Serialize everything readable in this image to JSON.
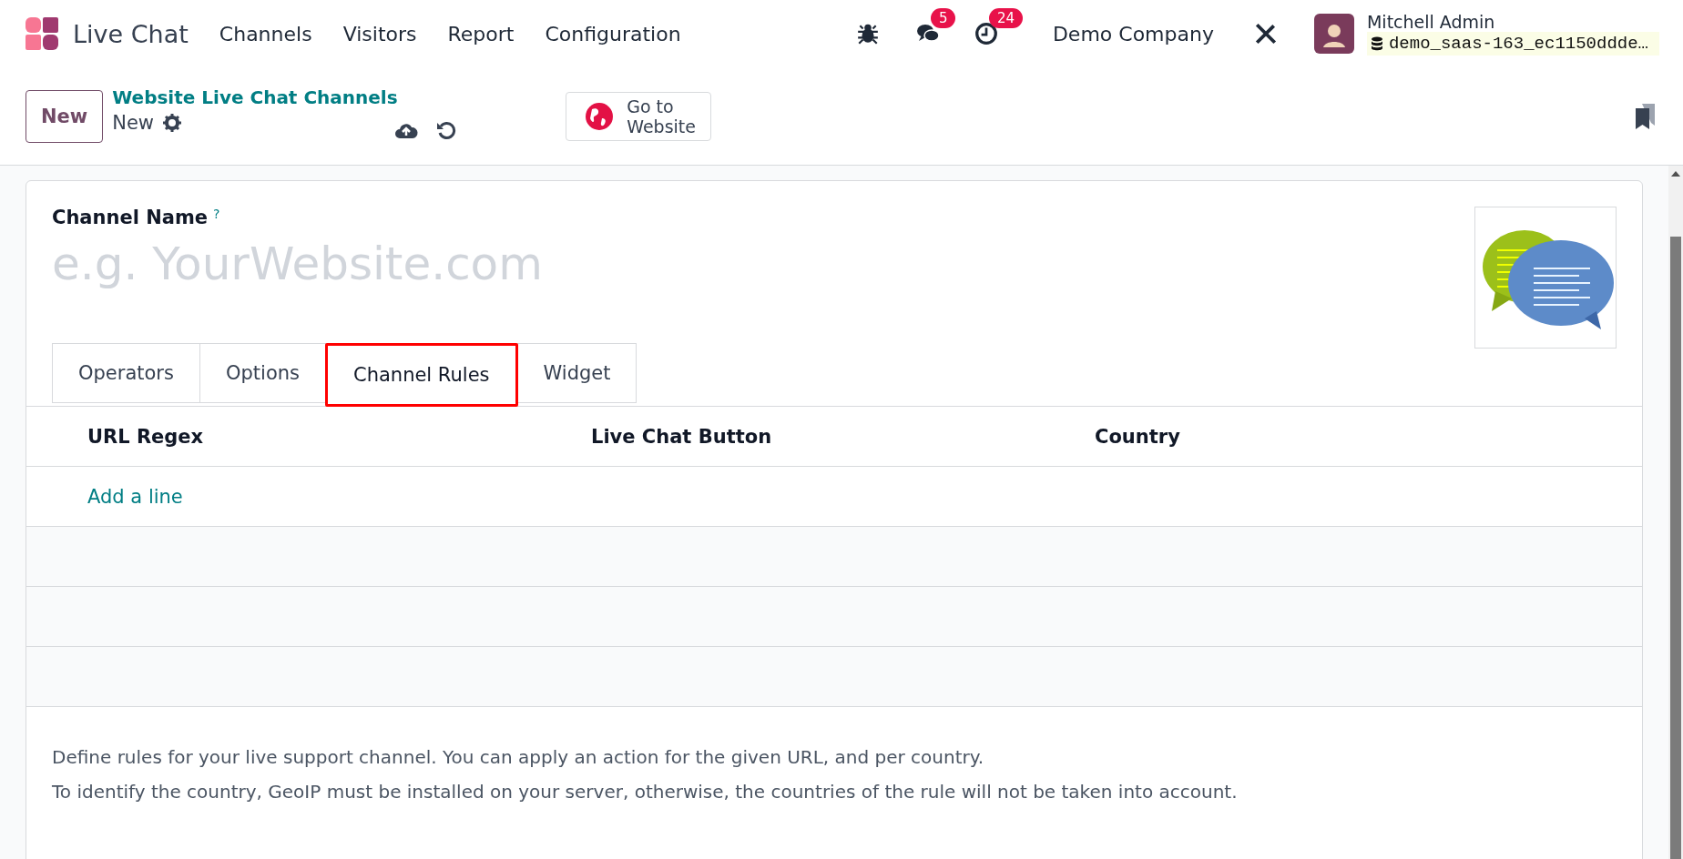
{
  "navbar": {
    "app_name": "Live Chat",
    "menu": [
      "Channels",
      "Visitors",
      "Report",
      "Configuration"
    ],
    "messages_badge": "5",
    "activities_badge": "24",
    "company": "Demo Company",
    "user_name": "Mitchell Admin",
    "database": "demo_saas-163_ec1150ddde…"
  },
  "control_panel": {
    "new_button": "New",
    "breadcrumb": "Website Live Chat Channels",
    "record_name": "New",
    "go_to_website": "Go to Website"
  },
  "form": {
    "field_label": "Channel Name",
    "help_mark": "?",
    "name_placeholder": "e.g. YourWebsite.com",
    "tabs": [
      {
        "label": "Operators",
        "selected": false,
        "highlighted": false
      },
      {
        "label": "Options",
        "selected": false,
        "highlighted": false
      },
      {
        "label": "Channel Rules",
        "selected": true,
        "highlighted": true
      },
      {
        "label": "Widget",
        "selected": false,
        "highlighted": false
      }
    ],
    "table": {
      "columns": [
        "URL Regex",
        "Live Chat Button",
        "Country"
      ],
      "add_line": "Add a line"
    },
    "help_text": [
      "Define rules for your live support channel. You can apply an action for the given URL, and per country.",
      "To identify the country, GeoIP must be installed on your server, otherwise, the countries of the rule will not be taken into account."
    ]
  }
}
